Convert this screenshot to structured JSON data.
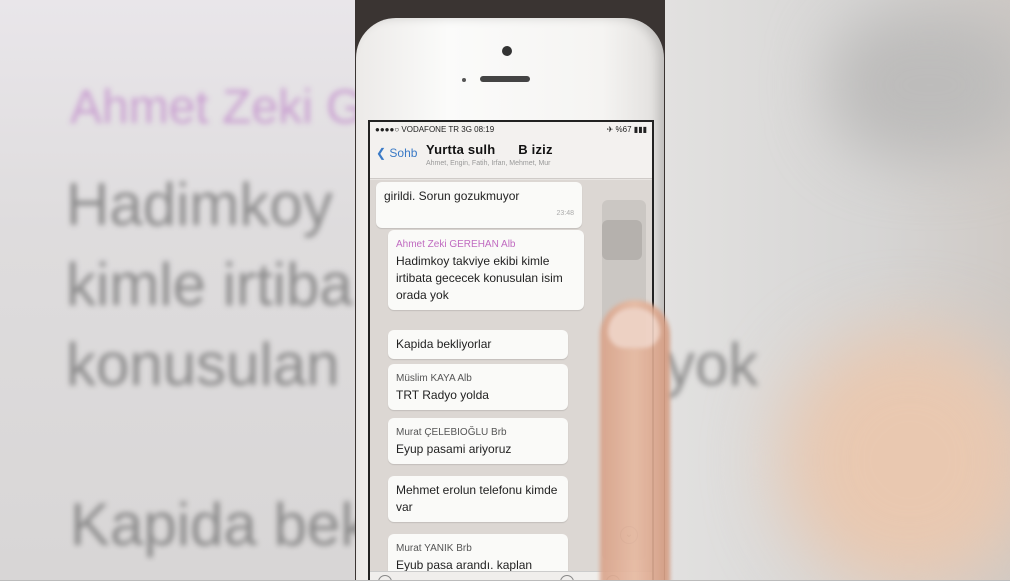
{
  "background_text": {
    "line1": "Ahmet Zeki GEREHAN Alb",
    "line2": "Hadimkoy",
    "line3": "kimle irtiba",
    "line4": "konusulan",
    "line5": "yok",
    "line6": "Kapida bek"
  },
  "status_bar": {
    "carrier": "●●●●○ VODAFONE TR  3G 08:19",
    "battery": "✈ %67 ▮▮▮"
  },
  "nav": {
    "back_label": "Sohb",
    "group_name": "Yurtta sulh      B iziz",
    "members": "Ahmet, Engin, Fatih, Irfan, Mehmet, Mur"
  },
  "messages": [
    {
      "sender": "",
      "text": "girildi. Sorun gozukmuyor",
      "time": "23:48"
    },
    {
      "sender": "Ahmet Zeki GEREHAN Alb",
      "text": "Hadimkoy takviye ekibi kimle irtibata gececek konusulan isim orada yok"
    },
    {
      "sender": "",
      "text": "Kapida bekliyorlar"
    },
    {
      "sender": "Müslim KAYA Alb",
      "text": "TRT Radyo yolda"
    },
    {
      "sender": "Murat ÇELEBIOĞLU Brb",
      "text": "Eyup pasami ariyoruz"
    },
    {
      "sender": "",
      "text": "Mehmet erolun telefonu kimde var"
    },
    {
      "sender": "Murat YANIK Brb",
      "text": "Eyub pasa arandı. kaplan"
    }
  ],
  "colors": {
    "accent": "#3a7ac6",
    "sender_pink": "#c06bc0"
  }
}
